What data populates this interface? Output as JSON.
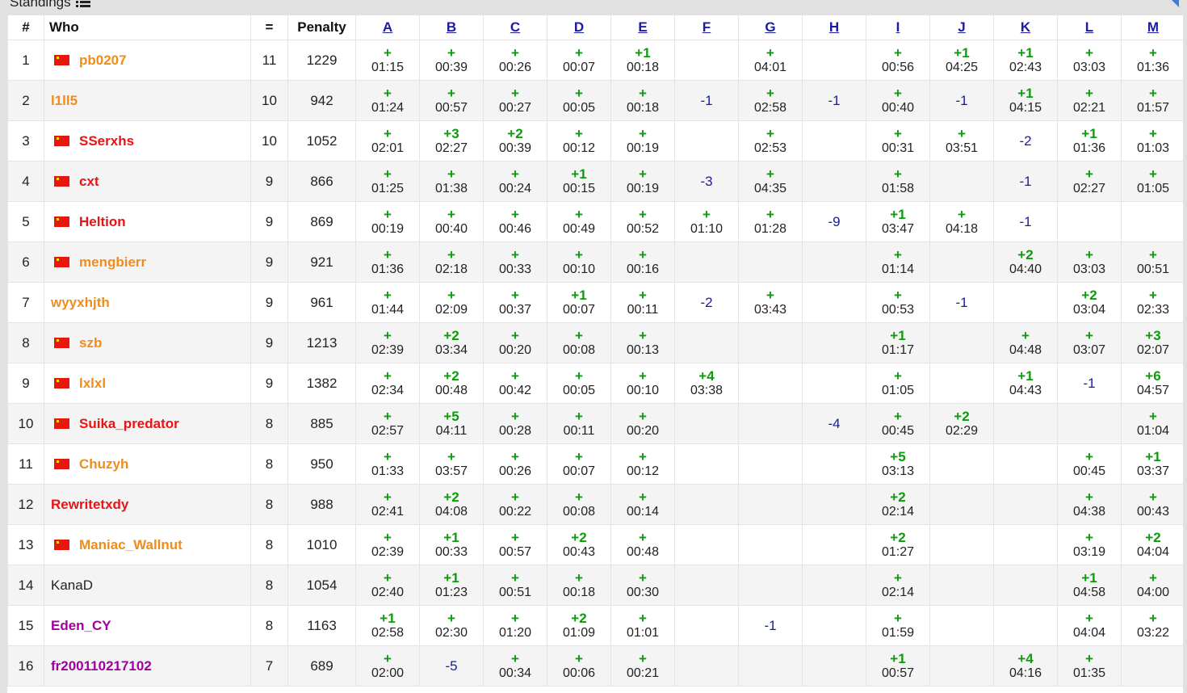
{
  "page": {
    "caption": "Standings",
    "colors": {
      "accepted": "#0a9d0a",
      "rejected": "#1a1aa6",
      "flag": "#e8160c",
      "orange_handle": "#f28c18",
      "red_handle": "#ee1111",
      "violet_handle": "#a0009f",
      "gray_handle": "#222222"
    }
  },
  "table": {
    "headers": {
      "rank": "#",
      "who": "Who",
      "solved": "=",
      "penalty": "Penalty"
    },
    "problems": [
      "A",
      "B",
      "C",
      "D",
      "E",
      "F",
      "G",
      "H",
      "I",
      "J",
      "K",
      "L",
      "M"
    ],
    "rows": [
      {
        "rank": "1",
        "handle": "pb0207",
        "flag": true,
        "color": "#f28c18",
        "solved": "11",
        "penalty": "1229",
        "cells": [
          [
            "+",
            "01:15"
          ],
          [
            "+",
            "00:39"
          ],
          [
            "+",
            "00:26"
          ],
          [
            "+",
            "00:07"
          ],
          [
            "+1",
            "00:18"
          ],
          null,
          [
            "+",
            "04:01"
          ],
          null,
          [
            "+",
            "00:56"
          ],
          [
            "+1",
            "04:25"
          ],
          [
            "+1",
            "02:43"
          ],
          [
            "+",
            "03:03"
          ],
          [
            "+",
            "01:36"
          ]
        ]
      },
      {
        "rank": "2",
        "handle": "l1ll5",
        "flag": false,
        "color": "#f28c18",
        "solved": "10",
        "penalty": "942",
        "cells": [
          [
            "+",
            "01:24"
          ],
          [
            "+",
            "00:57"
          ],
          [
            "+",
            "00:27"
          ],
          [
            "+",
            "00:05"
          ],
          [
            "+",
            "00:18"
          ],
          [
            "-1"
          ],
          [
            "+",
            "02:58"
          ],
          [
            "-1"
          ],
          [
            "+",
            "00:40"
          ],
          [
            "-1"
          ],
          [
            "+1",
            "04:15"
          ],
          [
            "+",
            "02:21"
          ],
          [
            "+",
            "01:57"
          ]
        ]
      },
      {
        "rank": "3",
        "handle": "SSerxhs",
        "flag": true,
        "color": "#ee1111",
        "solved": "10",
        "penalty": "1052",
        "cells": [
          [
            "+",
            "02:01"
          ],
          [
            "+3",
            "02:27"
          ],
          [
            "+2",
            "00:39"
          ],
          [
            "+",
            "00:12"
          ],
          [
            "+",
            "00:19"
          ],
          null,
          [
            "+",
            "02:53"
          ],
          null,
          [
            "+",
            "00:31"
          ],
          [
            "+",
            "03:51"
          ],
          [
            "-2"
          ],
          [
            "+1",
            "01:36"
          ],
          [
            "+",
            "01:03"
          ]
        ]
      },
      {
        "rank": "4",
        "handle": "cxt",
        "flag": true,
        "color": "#ee1111",
        "solved": "9",
        "penalty": "866",
        "cells": [
          [
            "+",
            "01:25"
          ],
          [
            "+",
            "01:38"
          ],
          [
            "+",
            "00:24"
          ],
          [
            "+1",
            "00:15"
          ],
          [
            "+",
            "00:19"
          ],
          [
            "-3"
          ],
          [
            "+",
            "04:35"
          ],
          null,
          [
            "+",
            "01:58"
          ],
          null,
          [
            "-1"
          ],
          [
            "+",
            "02:27"
          ],
          [
            "+",
            "01:05"
          ]
        ]
      },
      {
        "rank": "5",
        "handle": "Heltion",
        "flag": true,
        "color": "#ee1111",
        "solved": "9",
        "penalty": "869",
        "cells": [
          [
            "+",
            "00:19"
          ],
          [
            "+",
            "00:40"
          ],
          [
            "+",
            "00:46"
          ],
          [
            "+",
            "00:49"
          ],
          [
            "+",
            "00:52"
          ],
          [
            "+",
            "01:10"
          ],
          [
            "+",
            "01:28"
          ],
          [
            "-9"
          ],
          [
            "+1",
            "03:47"
          ],
          [
            "+",
            "04:18"
          ],
          [
            "-1"
          ],
          null,
          null
        ]
      },
      {
        "rank": "6",
        "handle": "mengbierr",
        "flag": true,
        "color": "#f28c18",
        "solved": "9",
        "penalty": "921",
        "cells": [
          [
            "+",
            "01:36"
          ],
          [
            "+",
            "02:18"
          ],
          [
            "+",
            "00:33"
          ],
          [
            "+",
            "00:10"
          ],
          [
            "+",
            "00:16"
          ],
          null,
          null,
          null,
          [
            "+",
            "01:14"
          ],
          null,
          [
            "+2",
            "04:40"
          ],
          [
            "+",
            "03:03"
          ],
          [
            "+",
            "00:51"
          ]
        ]
      },
      {
        "rank": "7",
        "handle": "wyyxhjth",
        "flag": false,
        "color": "#f28c18",
        "solved": "9",
        "penalty": "961",
        "cells": [
          [
            "+",
            "01:44"
          ],
          [
            "+",
            "02:09"
          ],
          [
            "+",
            "00:37"
          ],
          [
            "+1",
            "00:07"
          ],
          [
            "+",
            "00:11"
          ],
          [
            "-2"
          ],
          [
            "+",
            "03:43"
          ],
          null,
          [
            "+",
            "00:53"
          ],
          [
            "-1"
          ],
          null,
          [
            "+2",
            "03:04"
          ],
          [
            "+",
            "02:33"
          ]
        ]
      },
      {
        "rank": "8",
        "handle": "szb",
        "flag": true,
        "color": "#f28c18",
        "solved": "9",
        "penalty": "1213",
        "cells": [
          [
            "+",
            "02:39"
          ],
          [
            "+2",
            "03:34"
          ],
          [
            "+",
            "00:20"
          ],
          [
            "+",
            "00:08"
          ],
          [
            "+",
            "00:13"
          ],
          null,
          null,
          null,
          [
            "+1",
            "01:17"
          ],
          null,
          [
            "+",
            "04:48"
          ],
          [
            "+",
            "03:07"
          ],
          [
            "+3",
            "02:07"
          ]
        ]
      },
      {
        "rank": "9",
        "handle": "lxlxl",
        "flag": true,
        "color": "#f28c18",
        "solved": "9",
        "penalty": "1382",
        "cells": [
          [
            "+",
            "02:34"
          ],
          [
            "+2",
            "00:48"
          ],
          [
            "+",
            "00:42"
          ],
          [
            "+",
            "00:05"
          ],
          [
            "+",
            "00:10"
          ],
          [
            "+4",
            "03:38"
          ],
          null,
          null,
          [
            "+",
            "01:05"
          ],
          null,
          [
            "+1",
            "04:43"
          ],
          [
            "-1"
          ],
          [
            "+6",
            "04:57"
          ]
        ]
      },
      {
        "rank": "10",
        "handle": "Suika_predator",
        "flag": true,
        "color": "#ee1111",
        "solved": "8",
        "penalty": "885",
        "cells": [
          [
            "+",
            "02:57"
          ],
          [
            "+5",
            "04:11"
          ],
          [
            "+",
            "00:28"
          ],
          [
            "+",
            "00:11"
          ],
          [
            "+",
            "00:20"
          ],
          null,
          null,
          [
            "-4"
          ],
          [
            "+",
            "00:45"
          ],
          [
            "+2",
            "02:29"
          ],
          null,
          null,
          [
            "+",
            "01:04"
          ]
        ]
      },
      {
        "rank": "11",
        "handle": "Chuzyh",
        "flag": true,
        "color": "#f28c18",
        "solved": "8",
        "penalty": "950",
        "cells": [
          [
            "+",
            "01:33"
          ],
          [
            "+",
            "03:57"
          ],
          [
            "+",
            "00:26"
          ],
          [
            "+",
            "00:07"
          ],
          [
            "+",
            "00:12"
          ],
          null,
          null,
          null,
          [
            "+5",
            "03:13"
          ],
          null,
          null,
          [
            "+",
            "00:45"
          ],
          [
            "+1",
            "03:37"
          ]
        ]
      },
      {
        "rank": "12",
        "handle": "Rewritetxdy",
        "flag": false,
        "color": "#ee1111",
        "solved": "8",
        "penalty": "988",
        "cells": [
          [
            "+",
            "02:41"
          ],
          [
            "+2",
            "04:08"
          ],
          [
            "+",
            "00:22"
          ],
          [
            "+",
            "00:08"
          ],
          [
            "+",
            "00:14"
          ],
          null,
          null,
          null,
          [
            "+2",
            "02:14"
          ],
          null,
          null,
          [
            "+",
            "04:38"
          ],
          [
            "+",
            "00:43"
          ]
        ]
      },
      {
        "rank": "13",
        "handle": "Maniac_Wallnut",
        "flag": true,
        "color": "#f28c18",
        "solved": "8",
        "penalty": "1010",
        "cells": [
          [
            "+",
            "02:39"
          ],
          [
            "+1",
            "00:33"
          ],
          [
            "+",
            "00:57"
          ],
          [
            "+2",
            "00:43"
          ],
          [
            "+",
            "00:48"
          ],
          null,
          null,
          null,
          [
            "+2",
            "01:27"
          ],
          null,
          null,
          [
            "+",
            "03:19"
          ],
          [
            "+2",
            "04:04"
          ]
        ]
      },
      {
        "rank": "14",
        "handle": "KanaD",
        "flag": false,
        "color": "#222222",
        "plain": true,
        "solved": "8",
        "penalty": "1054",
        "cells": [
          [
            "+",
            "02:40"
          ],
          [
            "+1",
            "01:23"
          ],
          [
            "+",
            "00:51"
          ],
          [
            "+",
            "00:18"
          ],
          [
            "+",
            "00:30"
          ],
          null,
          null,
          null,
          [
            "+",
            "02:14"
          ],
          null,
          null,
          [
            "+1",
            "04:58"
          ],
          [
            "+",
            "04:00"
          ]
        ]
      },
      {
        "rank": "15",
        "handle": "Eden_CY",
        "flag": false,
        "color": "#a0009f",
        "solved": "8",
        "penalty": "1163",
        "cells": [
          [
            "+1",
            "02:58"
          ],
          [
            "+",
            "02:30"
          ],
          [
            "+",
            "01:20"
          ],
          [
            "+2",
            "01:09"
          ],
          [
            "+",
            "01:01"
          ],
          null,
          [
            "-1"
          ],
          null,
          [
            "+",
            "01:59"
          ],
          null,
          null,
          [
            "+",
            "04:04"
          ],
          [
            "+",
            "03:22"
          ]
        ]
      },
      {
        "rank": "16",
        "handle": "fr200110217102",
        "flag": false,
        "color": "#a0009f",
        "solved": "7",
        "penalty": "689",
        "cells": [
          [
            "+",
            "02:00"
          ],
          [
            "-5"
          ],
          [
            "+",
            "00:34"
          ],
          [
            "+",
            "00:06"
          ],
          [
            "+",
            "00:21"
          ],
          null,
          null,
          null,
          [
            "+1",
            "00:57"
          ],
          null,
          [
            "+4",
            "04:16"
          ],
          [
            "+",
            "01:35"
          ]
        ]
      }
    ]
  }
}
